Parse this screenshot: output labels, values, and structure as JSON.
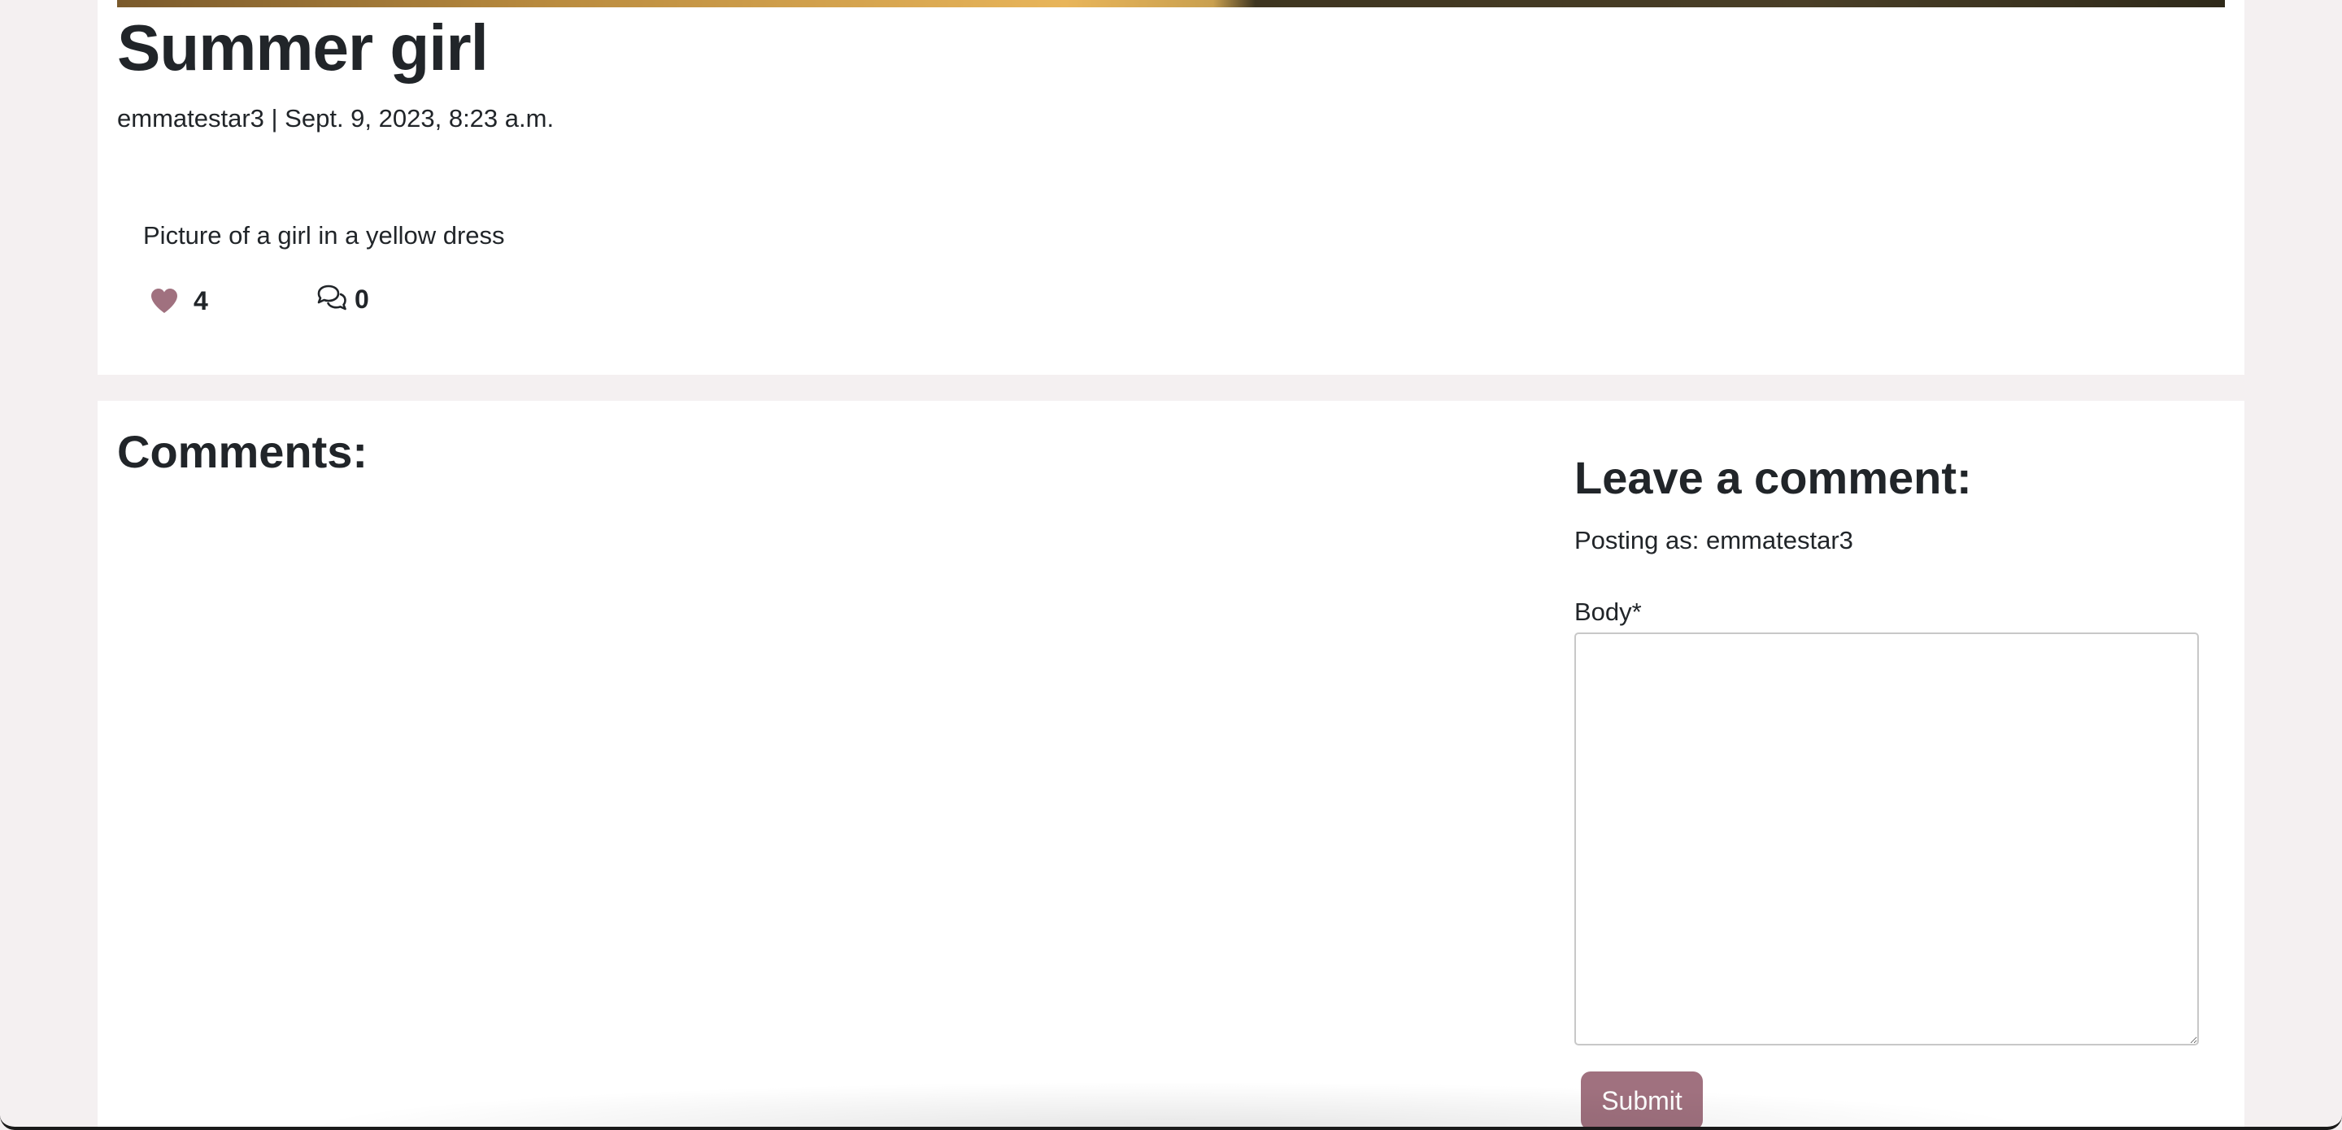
{
  "post": {
    "title": "Summer girl",
    "meta": "emmatestar3 | Sept. 9, 2023, 8:23 a.m.",
    "description": "Picture of a girl in a yellow dress",
    "likes": "4",
    "comments": "0"
  },
  "comments_section": {
    "heading": "Comments:"
  },
  "comment_form": {
    "heading": "Leave a comment:",
    "posting_as": "Posting as: emmatestar3",
    "body_label": "Body*",
    "body_value": "",
    "submit_label": "Submit"
  },
  "colors": {
    "accent": "#a0717f",
    "page_background": "#f4f0f1",
    "card_background": "#ffffff",
    "text": "#212529"
  },
  "icons": {
    "like": "heart-icon",
    "comments": "chat-bubbles-icon"
  }
}
